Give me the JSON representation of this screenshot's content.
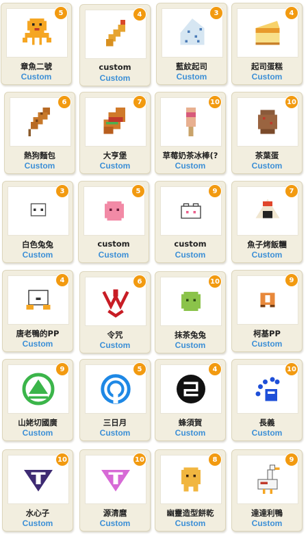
{
  "accent_color": "#f29a10",
  "link_color": "#3c8fd6",
  "items": [
    {
      "name": "章魚二號",
      "count": "5",
      "source": "Custom",
      "icon": "octopus-icon"
    },
    {
      "name": "custom",
      "count": "4",
      "source": "Custom",
      "icon": "fried-shrimp-icon"
    },
    {
      "name": "藍紋起司",
      "count": "3",
      "source": "Custom",
      "icon": "blue-cheese-icon"
    },
    {
      "name": "起司蛋糕",
      "count": "4",
      "source": "Custom",
      "icon": "cheesecake-icon"
    },
    {
      "name": "熱狗麵包",
      "count": "6",
      "source": "Custom",
      "icon": "corn-dog-icon"
    },
    {
      "name": "大亨堡",
      "count": "7",
      "source": "Custom",
      "icon": "hotdog-sandwich-icon"
    },
    {
      "name": "草莓奶茶冰棒(?",
      "count": "10",
      "source": "Custom",
      "icon": "popsicle-icon"
    },
    {
      "name": "茶葉蛋",
      "count": "10",
      "source": "Custom",
      "icon": "tea-egg-icon"
    },
    {
      "name": "白色兔兔",
      "count": "3",
      "source": "Custom",
      "icon": "white-bunny-icon"
    },
    {
      "name": "custom",
      "count": "5",
      "source": "Custom",
      "icon": "pink-blob-icon"
    },
    {
      "name": "custom",
      "count": "9",
      "source": "Custom",
      "icon": "paw-icon"
    },
    {
      "name": "魚子烤飯糰",
      "count": "7",
      "source": "Custom",
      "icon": "onigiri-icon"
    },
    {
      "name": "唐老鴨的PP",
      "count": "4",
      "source": "Custom",
      "icon": "duck-butt-icon"
    },
    {
      "name": "令咒",
      "count": "6",
      "source": "Custom",
      "icon": "command-seal-icon"
    },
    {
      "name": "抹茶兔兔",
      "count": "10",
      "source": "Custom",
      "icon": "matcha-bunny-icon"
    },
    {
      "name": "柯基PP",
      "count": "9",
      "source": "Custom",
      "icon": "corgi-butt-icon"
    },
    {
      "name": "山姥切國廣",
      "count": "9",
      "source": "Custom",
      "icon": "green-crest-icon"
    },
    {
      "name": "三日月",
      "count": "5",
      "source": "Custom",
      "icon": "blue-crest-icon"
    },
    {
      "name": "蜂須賀",
      "count": "4",
      "source": "Custom",
      "icon": "black-crest-icon"
    },
    {
      "name": "長義",
      "count": "10",
      "source": "Custom",
      "icon": "blue-dots-crest-icon"
    },
    {
      "name": "水心子",
      "count": "10",
      "source": "Custom",
      "icon": "purple-triangle-crest-icon"
    },
    {
      "name": "源清麿",
      "count": "10",
      "source": "Custom",
      "icon": "pink-triangle-crest-icon"
    },
    {
      "name": "幽靈造型餅乾",
      "count": "8",
      "source": "Custom",
      "icon": "ghost-cookie-icon"
    },
    {
      "name": "達達利鴨",
      "count": "9",
      "source": "Custom",
      "icon": "goose-icon"
    }
  ]
}
